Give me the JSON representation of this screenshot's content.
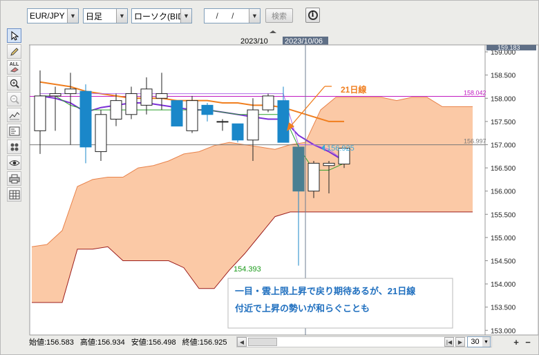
{
  "toolbar": {
    "pair": "EUR/JPY",
    "timeframe": "日足",
    "chart_type": "ローソク(BID)",
    "date_value": "/ /",
    "search_label": "検索",
    "info_icon": "info-icon"
  },
  "tools": [
    "cursor-icon",
    "pencil-icon",
    "clear-all-icon",
    "zoom-in-icon",
    "zoom-out-icon",
    "indicator-icon",
    "price-scale-icon",
    "settings-icon",
    "eye-icon",
    "print-icon",
    "table-icon"
  ],
  "tools_all_label": "ALL",
  "date_header": {
    "left_label": "2023/10",
    "cursor_label": "2023/10/06"
  },
  "status": {
    "open": "始値:156.583",
    "high": "高値:156.934",
    "low": "安値:156.498",
    "close": "終値:156.925",
    "count": "30"
  },
  "chart_data": {
    "type": "candlestick",
    "symbol": "EUR/JPY",
    "timeframe": "日足",
    "ylim": [
      152.9,
      159.15
    ],
    "y_ticks": [
      "159.000",
      "158.500",
      "158.000",
      "157.500",
      "157.000",
      "156.500",
      "156.000",
      "155.500",
      "155.000",
      "154.500",
      "154.000",
      "153.500",
      "153.000"
    ],
    "top_partial_tick": "159.183",
    "candles": [
      {
        "o": 157.3,
        "h": 158.6,
        "l": 156.8,
        "c": 158.05
      },
      {
        "o": 158.05,
        "h": 158.25,
        "l": 157.3,
        "c": 158.1
      },
      {
        "o": 158.1,
        "h": 158.55,
        "l": 157.0,
        "c": 158.2
      },
      {
        "o": 158.15,
        "h": 158.3,
        "l": 156.6,
        "c": 156.95
      },
      {
        "o": 156.85,
        "h": 157.75,
        "l": 156.65,
        "c": 157.65
      },
      {
        "o": 157.55,
        "h": 158.1,
        "l": 157.4,
        "c": 157.95
      },
      {
        "o": 157.65,
        "h": 158.25,
        "l": 157.55,
        "c": 158.1
      },
      {
        "o": 157.85,
        "h": 158.45,
        "l": 157.65,
        "c": 158.2
      },
      {
        "o": 158.0,
        "h": 158.55,
        "l": 157.75,
        "c": 158.1
      },
      {
        "o": 157.95,
        "h": 157.95,
        "l": 157.4,
        "c": 157.4
      },
      {
        "o": 157.3,
        "h": 158.05,
        "l": 157.25,
        "c": 157.95
      },
      {
        "o": 157.85,
        "h": 157.9,
        "l": 157.5,
        "c": 157.65
      },
      {
        "o": 157.5,
        "h": 157.55,
        "l": 157.3,
        "c": 157.5
      },
      {
        "o": 157.45,
        "h": 157.45,
        "l": 157.05,
        "c": 157.1
      },
      {
        "o": 157.1,
        "h": 158.0,
        "l": 156.65,
        "c": 157.75
      },
      {
        "o": 157.75,
        "h": 158.1,
        "l": 157.7,
        "c": 158.05
      },
      {
        "o": 157.95,
        "h": 158.25,
        "l": 157.3,
        "c": 157.05
      },
      {
        "o": 156.95,
        "h": 157.0,
        "l": 154.393,
        "c": 156.0
      },
      {
        "o": 156.0,
        "h": 156.65,
        "l": 155.85,
        "c": 156.6
      },
      {
        "o": 156.55,
        "h": 156.65,
        "l": 155.95,
        "c": 156.6
      },
      {
        "o": 156.583,
        "h": 156.934,
        "l": 156.498,
        "c": 156.925
      }
    ],
    "ichimoku_cloud": {
      "upper": [
        157.75,
        157.95,
        158.02,
        158.02,
        158.02,
        157.95,
        158.02,
        158.02,
        157.82,
        157.82,
        157.82,
        157.82
      ],
      "upper_start": [
        157.5,
        156.9,
        156.98,
        157.05,
        157.25
      ],
      "lower": [
        154.55,
        154.55,
        154.9,
        154.8,
        154.5,
        154.0,
        154.0,
        154.3,
        154.55,
        154.6,
        154.5,
        154.55
      ]
    },
    "lines": {
      "ma21": {
        "name": "21日線",
        "color": "#f07e1e",
        "values": [
          158.35,
          158.3,
          158.25,
          158.15,
          158.1,
          158.05,
          158.0,
          158.0,
          158.0,
          157.95,
          157.95,
          157.95,
          157.9,
          157.9,
          157.85,
          157.85,
          157.8,
          157.7,
          157.6,
          157.5,
          157.5
        ]
      },
      "purple": {
        "color": "#7b2fd6",
        "values": [
          158.05,
          158.0,
          157.9,
          157.7,
          157.8,
          157.85,
          157.9,
          157.9,
          157.85,
          157.8,
          157.75,
          157.75,
          157.7,
          157.65,
          157.6,
          157.55,
          157.55,
          157.2,
          157.0,
          156.85,
          156.65
        ]
      },
      "green": {
        "color": "#2ca02c",
        "values": [
          158.05,
          158.05,
          157.85,
          157.75,
          157.75,
          157.75,
          157.75,
          157.75,
          157.75,
          157.75,
          157.75,
          157.75,
          157.7,
          157.65,
          157.65,
          157.65,
          157.65,
          156.95,
          156.45,
          156.45,
          156.6
        ]
      },
      "lavender": {
        "color": "#b06ce8",
        "values": [
          158.1,
          158.1,
          158.1,
          158.1,
          158.1,
          158.1,
          158.1,
          158.1,
          158.1,
          158.1,
          158.1,
          158.1,
          158.1,
          158.1,
          158.1,
          158.1,
          158.1,
          157.0,
          157.0,
          156.9,
          156.65
        ]
      }
    },
    "hlines": [
      {
        "value": 158.042,
        "label": "158.042",
        "color": "#c018c0"
      },
      {
        "value": 156.997,
        "label": "156.997",
        "color": "#777777"
      }
    ],
    "current_price": "156.925",
    "low_label": "154.393",
    "ma_label": "21日線",
    "annotation": [
      "一目・雲上限上昇で戻り期待あるが、21日線",
      "付近で上昇の勢いが和らぐことも"
    ]
  }
}
